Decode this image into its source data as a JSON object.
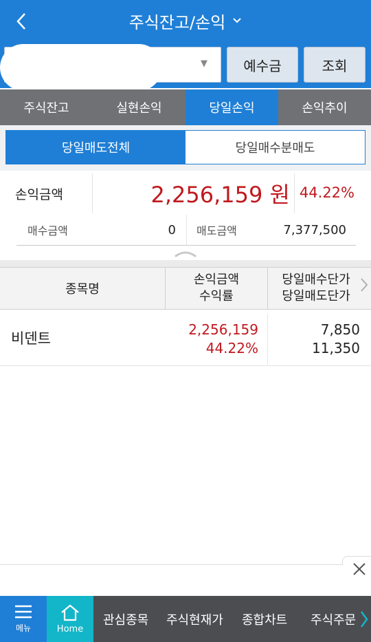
{
  "header": {
    "title": "주식잔고/손익",
    "back_icon": "chevron-left-icon",
    "title_dropdown_icon": "chevron-down-icon"
  },
  "account": {
    "number_visible": "70",
    "dropdown_icon": "caret-down-icon"
  },
  "buttons": {
    "deposit": "예수금",
    "query": "조회"
  },
  "tabs": [
    {
      "label": "주식잔고",
      "active": false
    },
    {
      "label": "실현손익",
      "active": false
    },
    {
      "label": "당일손익",
      "active": true
    },
    {
      "label": "손익추이",
      "active": false
    }
  ],
  "subtabs": [
    {
      "label": "당일매도전체",
      "active": true
    },
    {
      "label": "당일매수분매도",
      "active": false
    }
  ],
  "summary": {
    "pl_label": "손익금액",
    "pl_amount": "2,256,159 원",
    "pl_rate": "44.22%",
    "buy_label": "매수금액",
    "buy_value": "0",
    "sell_label": "매도금액",
    "sell_value": "7,377,500"
  },
  "table": {
    "headers": {
      "name": "종목명",
      "pl_line1": "손익금액",
      "pl_line2": "수익률",
      "price_line1": "당일매수단가",
      "price_line2": "당일매도단가"
    },
    "rows": [
      {
        "name": "비덴트",
        "pl_amount": "2,256,159",
        "pl_rate": "44.22%",
        "buy_price": "7,850",
        "sell_price": "11,350"
      }
    ]
  },
  "bottom_nav": {
    "menu_label": "메뉴",
    "home_label": "Home",
    "items": [
      "관심종목",
      "주식현재가",
      "종합차트",
      "주식주문"
    ]
  },
  "colors": {
    "primary": "#1f7fd6",
    "loss_profit_red": "#c0191f",
    "home_teal": "#13b6c9",
    "tab_gray": "#6f7175"
  }
}
